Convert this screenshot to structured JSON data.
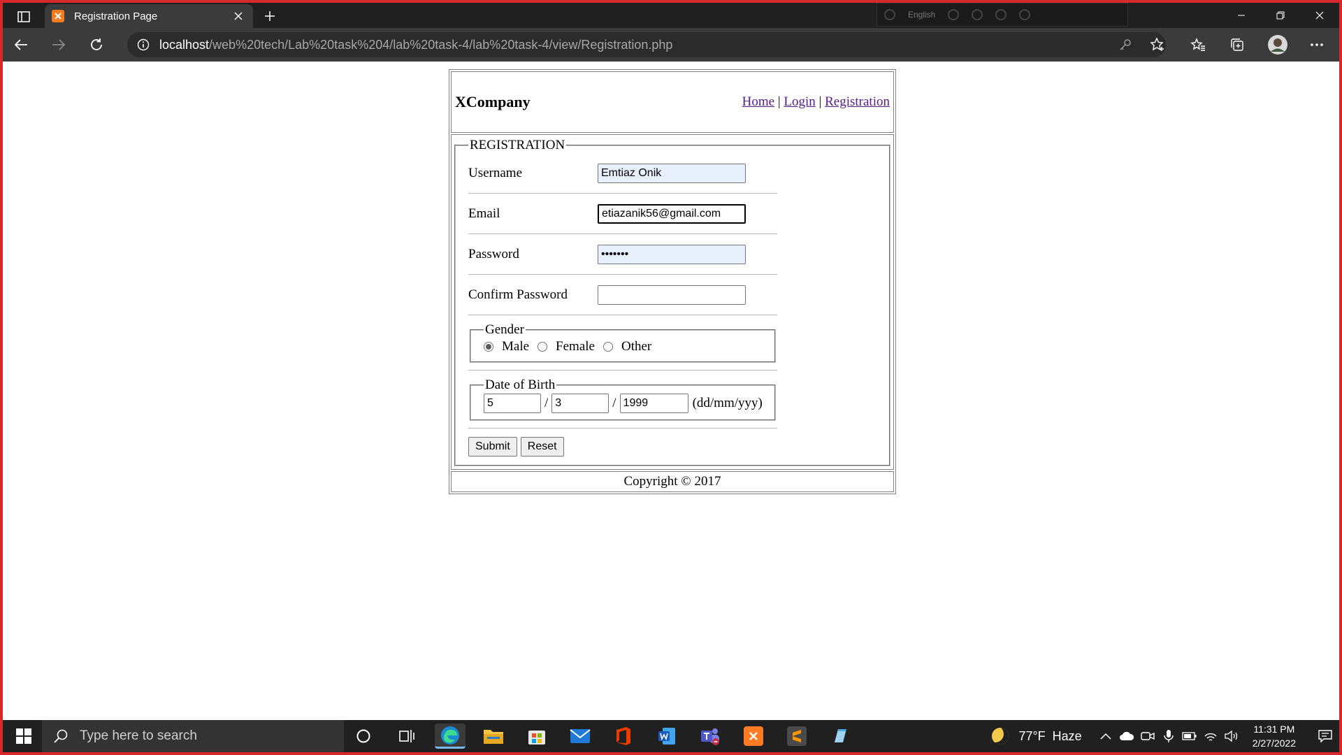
{
  "browser": {
    "tab": {
      "title": "Registration Page"
    },
    "url": {
      "host": "localhost",
      "path": "/web%20tech/Lab%20task%204/lab%20task-4/lab%20task-4/view/Registration.php"
    },
    "ime_language": "English",
    "accent": "#d9272e"
  },
  "page": {
    "logo": "XCompany",
    "nav": {
      "home": "Home",
      "sep": "|",
      "login": "Login",
      "registration": "Registration"
    },
    "form": {
      "legend": "REGISTRATION",
      "username": {
        "label": "Username",
        "value": "Emtiaz Onik"
      },
      "email": {
        "label": "Email",
        "value": "etiazanik56@gmail.com"
      },
      "password": {
        "label": "Password",
        "value": "•••••••"
      },
      "confirm_password": {
        "label": "Confirm Password",
        "value": ""
      },
      "gender": {
        "legend": "Gender",
        "options": [
          "Male",
          "Female",
          "Other"
        ],
        "selected": "Male"
      },
      "dob": {
        "legend": "Date of Birth",
        "day": "5",
        "month": "3",
        "year": "1999",
        "slash": "/",
        "format": "(dd/mm/yyy)"
      },
      "submit_label": "Submit",
      "reset_label": "Reset"
    },
    "footer": "Copyright © 2017"
  },
  "taskbar": {
    "search_placeholder": "Type here to search",
    "apps": [
      "Cortana",
      "Task View",
      "Microsoft Edge",
      "File Explorer",
      "Microsoft Store",
      "Mail",
      "Office",
      "Word",
      "Teams",
      "XAMPP",
      "Sublime Text",
      "Notepad"
    ],
    "weather": {
      "temp": "77°F",
      "condition": "Haze"
    },
    "clock": {
      "time": "11:31 PM",
      "date": "2/27/2022"
    }
  }
}
